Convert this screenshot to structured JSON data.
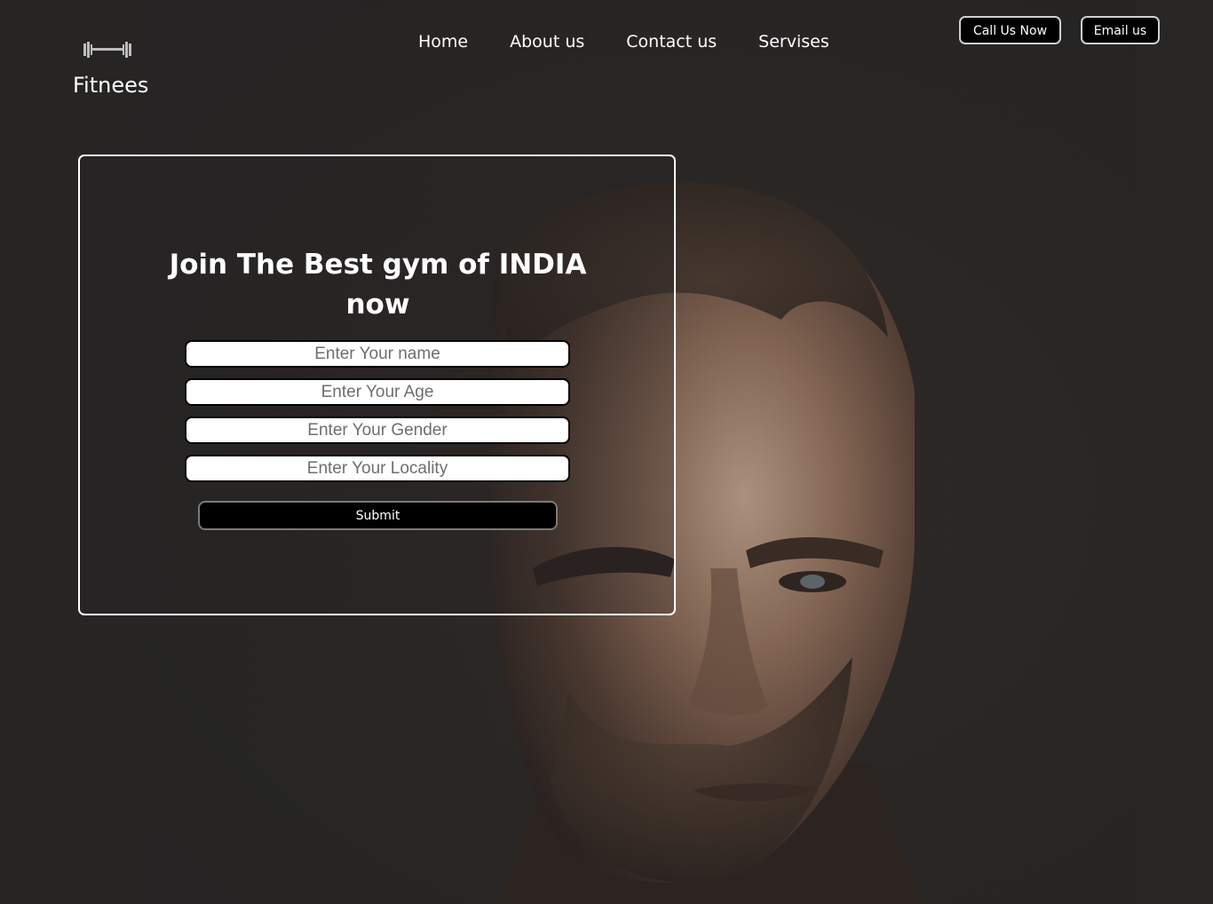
{
  "brand": {
    "name": "Fitnees",
    "icon": "dumbbell-icon"
  },
  "nav": {
    "items": [
      {
        "label": "Home"
      },
      {
        "label": "About us"
      },
      {
        "label": "Contact us"
      },
      {
        "label": "Servises"
      }
    ]
  },
  "header_buttons": {
    "call_label": "Call Us Now",
    "email_label": "Email us"
  },
  "form": {
    "title_line1": "Join The Best gym of INDIA",
    "title_line2": "now",
    "fields": [
      {
        "placeholder": "Enter Your name",
        "value": ""
      },
      {
        "placeholder": "Enter Your Age",
        "value": ""
      },
      {
        "placeholder": "Enter Your Gender",
        "value": ""
      },
      {
        "placeholder": "Enter Your Locality",
        "value": ""
      }
    ],
    "submit_label": "Submit"
  },
  "colors": {
    "background": "#262524",
    "text": "#ffffff",
    "button_bg": "#000000",
    "field_bg": "#ffffff"
  }
}
